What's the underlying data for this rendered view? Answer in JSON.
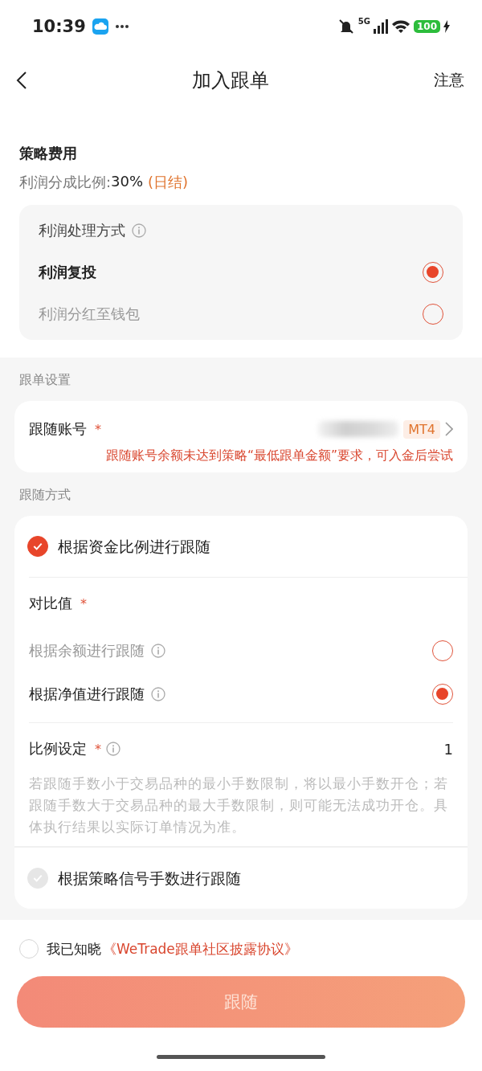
{
  "status_bar": {
    "time": "10:39",
    "network": "5G",
    "battery": "100"
  },
  "nav": {
    "title": "加入跟单",
    "action": "注意"
  },
  "fee": {
    "title": "策略费用",
    "ratio_label": "利润分成比例: ",
    "ratio_value": "30%",
    "settle": "(日结)",
    "profit_mode": {
      "title": "利润处理方式",
      "options": [
        {
          "label": "利润复投",
          "selected": true
        },
        {
          "label": "利润分红至钱包",
          "selected": false
        }
      ]
    }
  },
  "follow_settings": {
    "section": "跟单设置",
    "account": {
      "label": "跟随账号",
      "required": "*",
      "tag": "MT4",
      "warning": "跟随账号余额未达到策略“最低跟单金额”要求，可入金后尝试"
    }
  },
  "follow_method": {
    "section": "跟随方式",
    "by_funds": {
      "label": "根据资金比例进行跟随",
      "checked": true,
      "disabled": false
    },
    "compare": {
      "label": "对比值",
      "required": "*",
      "options": [
        {
          "label": "根据余额进行跟随",
          "selected": false
        },
        {
          "label": "根据净值进行跟随",
          "selected": true
        }
      ]
    },
    "ratio": {
      "label": "比例设定",
      "required": "*",
      "value": "1",
      "note": "若跟随手数小于交易品种的最小手数限制，将以最小手数开仓；若跟随手数大于交易品种的最大手数限制，则可能无法成功开仓。具体执行结果以实际订单情况为准。"
    },
    "by_signal": {
      "label": "根据策略信号手数进行跟随",
      "checked": true,
      "disabled": true
    }
  },
  "agreement": {
    "checked": false,
    "prefix": "我已知晓",
    "link": "《WeTrade跟单社区披露协议》"
  },
  "submit": {
    "label": "跟随",
    "disabled": true
  }
}
